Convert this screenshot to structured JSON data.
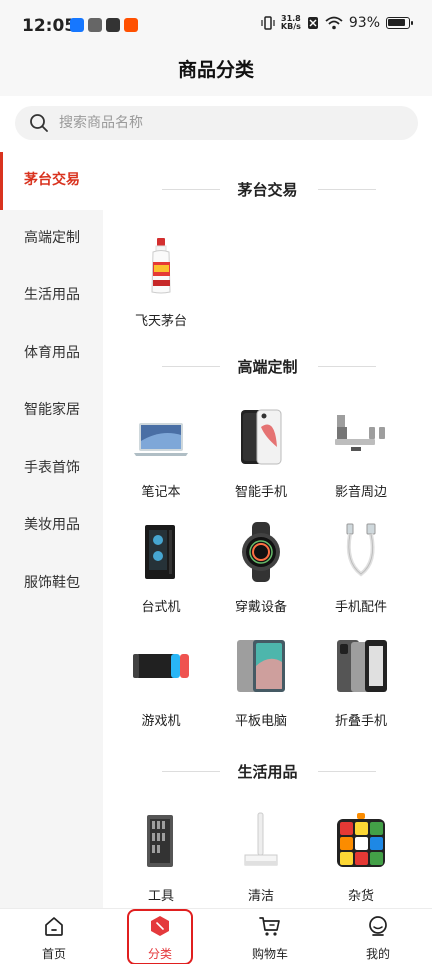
{
  "status_bar": {
    "time": "12:05",
    "net_speed_value": "31.8",
    "net_speed_unit": "KB/s",
    "battery_percent": "93%",
    "app_icons": [
      "alipay-icon",
      "mail-icon",
      "link-icon",
      "taobao-icon"
    ]
  },
  "header": {
    "title": "商品分类"
  },
  "search": {
    "placeholder": "搜索商品名称"
  },
  "sidebar": {
    "items": [
      {
        "label": "茅台交易",
        "active": true
      },
      {
        "label": "高端定制"
      },
      {
        "label": "生活用品"
      },
      {
        "label": "体育用品"
      },
      {
        "label": "智能家居"
      },
      {
        "label": "手表首饰"
      },
      {
        "label": "美妆用品"
      },
      {
        "label": "服饰鞋包"
      }
    ]
  },
  "sections": [
    {
      "title": "茅台交易",
      "items": [
        {
          "label": "飞天茅台",
          "icon": "moutai-bottle-icon"
        }
      ]
    },
    {
      "title": "高端定制",
      "items": [
        {
          "label": "笔记本",
          "icon": "laptop-icon"
        },
        {
          "label": "智能手机",
          "icon": "smartphone-icon"
        },
        {
          "label": "影音周边",
          "icon": "speaker-icon"
        },
        {
          "label": "台式机",
          "icon": "desktop-tower-icon"
        },
        {
          "label": "穿戴设备",
          "icon": "smartwatch-icon"
        },
        {
          "label": "手机配件",
          "icon": "usb-cable-icon"
        },
        {
          "label": "游戏机",
          "icon": "game-console-icon"
        },
        {
          "label": "平板电脑",
          "icon": "tablet-icon"
        },
        {
          "label": "折叠手机",
          "icon": "foldable-phone-icon"
        }
      ]
    },
    {
      "title": "生活用品",
      "items": [
        {
          "label": "工具",
          "icon": "toolkit-icon"
        },
        {
          "label": "清洁",
          "icon": "mop-icon"
        },
        {
          "label": "杂货",
          "icon": "rubiks-cube-icon"
        }
      ]
    }
  ],
  "bottom_nav": {
    "items": [
      {
        "label": "首页",
        "icon": "home-icon"
      },
      {
        "label": "分类",
        "icon": "category-icon",
        "active": true
      },
      {
        "label": "购物车",
        "icon": "cart-icon"
      },
      {
        "label": "我的",
        "icon": "profile-icon"
      }
    ]
  },
  "colors": {
    "accent": "#d9331f",
    "sidebar_bg": "#f5f5f5",
    "header_bg": "#f7f7f7"
  }
}
